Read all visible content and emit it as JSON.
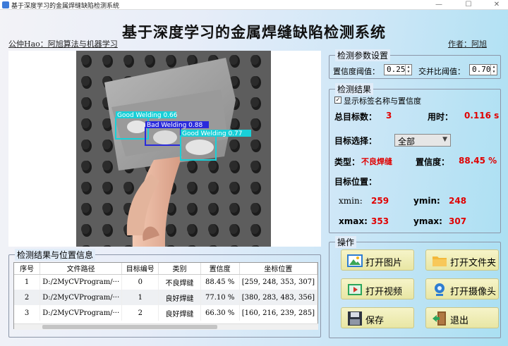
{
  "window": {
    "title": "基于深度学习的金属焊缝缺陷检测系统",
    "min": "—",
    "max": "☐",
    "close": "✕"
  },
  "header": {
    "title": "基于深度学习的金属焊缝缺陷检测系统",
    "left_text": "公仲Hao：阿旭算法与机器学习",
    "right_text": "作者：阿旭"
  },
  "detections_overlay": [
    {
      "label": "Good Welding  0.66"
    },
    {
      "label": "Bad Welding  0.88"
    },
    {
      "label": "Good Welding  0.77"
    }
  ],
  "params": {
    "title": "检测参数设置",
    "conf_label": "置信度阈值：",
    "conf_value": "0.25",
    "iou_label": "交并比阈值：",
    "iou_value": "0.70"
  },
  "results": {
    "title": "检测结果",
    "show_labels": "显示标签名称与置信度",
    "total_label": "总目标数：",
    "total_value": "3",
    "time_label": "用时：",
    "time_value": "0.116 s",
    "select_label": "目标选择：",
    "select_value": "全部",
    "type_label": "类型：",
    "type_value": "不良焊缝",
    "conf_label": "置信度：",
    "conf_value": "88.45 %",
    "pos_label": "目标位置：",
    "xmin_label": "xmin:",
    "xmin_value": "259",
    "ymin_label": "ymin:",
    "ymin_value": "248",
    "xmax_label": "xmax:",
    "xmax_value": "353",
    "ymax_label": "ymax:",
    "ymax_value": "307"
  },
  "ops": {
    "title": "操作",
    "open_image": "打开图片",
    "open_folder": "打开文件夹",
    "open_video": "打开视频",
    "open_camera": "打开摄像头",
    "save": "保存",
    "exit": "退出"
  },
  "table": {
    "title": "检测结果与位置信息",
    "columns": [
      "序号",
      "文件路径",
      "目标编号",
      "类别",
      "置信度",
      "坐标位置"
    ],
    "rows": [
      [
        "1",
        "D:/2MyCVProgram/···",
        "0",
        "不良焊缝",
        "88.45 %",
        "[259, 248, 353, 307]"
      ],
      [
        "2",
        "D:/2MyCVProgram/···",
        "1",
        "良好焊缝",
        "77.10 %",
        "[380, 283, 483, 356]"
      ],
      [
        "3",
        "D:/2MyCVProgram/···",
        "2",
        "良好焊缝",
        "66.30 %",
        "[160, 216, 239, 285]"
      ]
    ]
  },
  "colors": {
    "red_value": "#e00000",
    "button_bg": "#f1efbb",
    "box_cyan": "#19d0d8",
    "box_blue": "#2a2adc"
  }
}
